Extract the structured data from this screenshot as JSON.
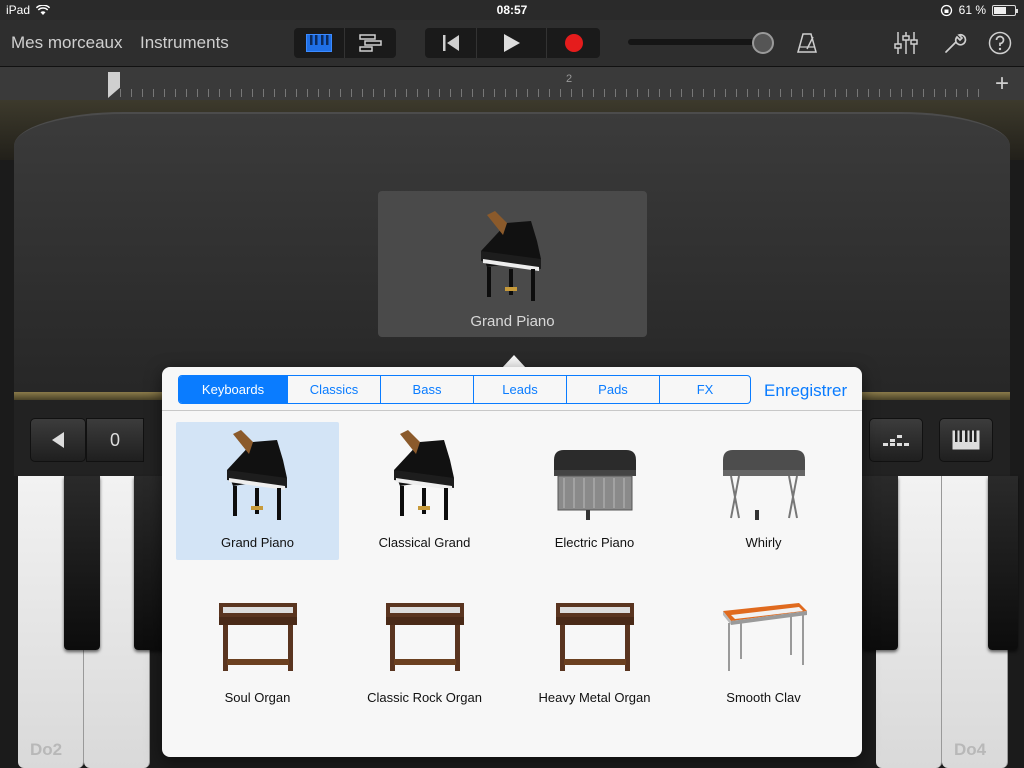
{
  "status": {
    "device": "iPad",
    "time": "08:57",
    "battery": "61 %",
    "battery_level": 0.61
  },
  "toolbar": {
    "my_songs": "Mes morceaux",
    "instruments": "Instruments"
  },
  "ruler": {
    "marks": [
      "1",
      "2"
    ]
  },
  "colors": {
    "accent": "#0a7cff",
    "record": "#e51c1c",
    "selected_cell": "#d3e4f6"
  },
  "instrument": {
    "name": "Grand Piano"
  },
  "controls": {
    "octave": "0"
  },
  "keyboard": {
    "labels": [
      "Do2",
      "Do4"
    ]
  },
  "popover": {
    "tabs": [
      {
        "label": "Keyboards",
        "active": true
      },
      {
        "label": "Classics"
      },
      {
        "label": "Bass"
      },
      {
        "label": "Leads"
      },
      {
        "label": "Pads"
      },
      {
        "label": "FX"
      }
    ],
    "save": "Enregistrer",
    "instruments": [
      {
        "name": "Grand Piano",
        "icon": "grand-piano-icon"
      },
      {
        "name": "Classical Grand",
        "icon": "grand-piano-icon"
      },
      {
        "name": "Electric Piano",
        "icon": "electric-piano-icon"
      },
      {
        "name": "Whirly",
        "icon": "electric-piano-icon"
      },
      {
        "name": "Soul Organ",
        "icon": "organ-icon"
      },
      {
        "name": "Classic Rock Organ",
        "icon": "organ-icon"
      },
      {
        "name": "Heavy Metal Organ",
        "icon": "organ-icon"
      },
      {
        "name": "Smooth Clav",
        "icon": "clavinet-icon"
      }
    ]
  }
}
